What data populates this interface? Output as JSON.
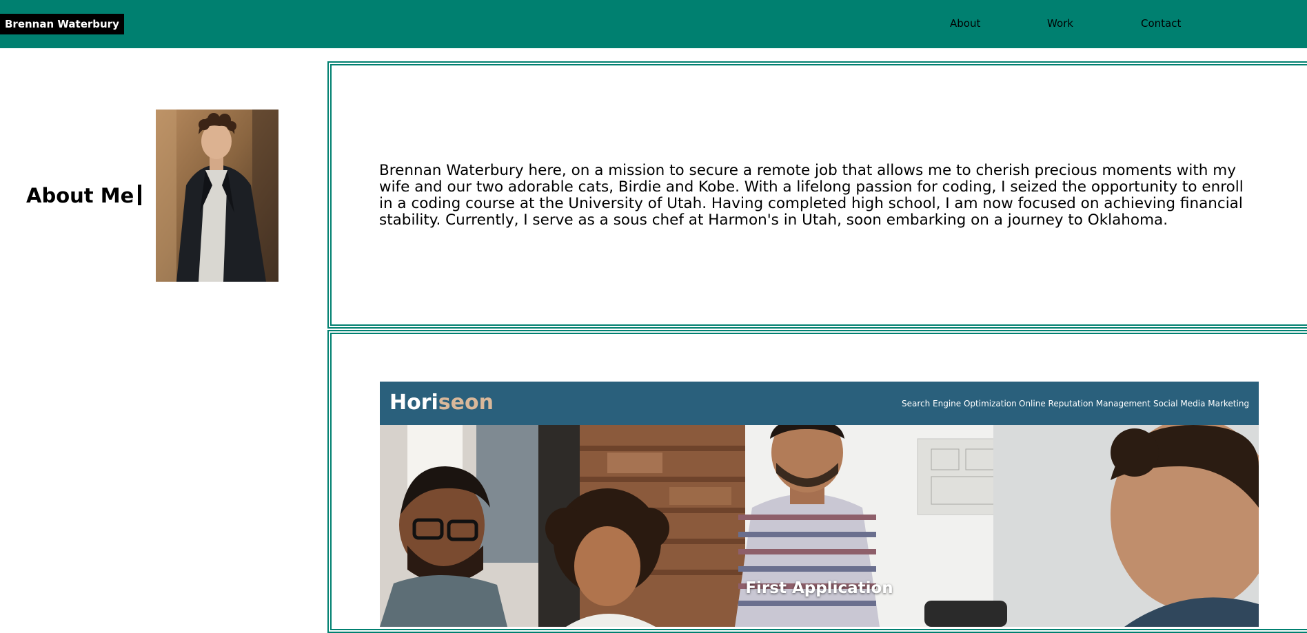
{
  "header": {
    "brand": "Brennan Waterbury",
    "nav": [
      "About",
      "Work",
      "Contact"
    ]
  },
  "about": {
    "heading": "About Me",
    "bio": "Brennan Waterbury here, on a mission to secure a remote job that allows me to cherish precious moments with my wife and our two adorable cats, Birdie and Kobe. With a lifelong passion for coding, I seized the opportunity to enroll in a coding course at the University of Utah. Having completed high school, I am now focused on achieving financial stability. Currently, I serve as a sous chef at Harmon's in Utah, soon embarking on a journey to Oklahoma."
  },
  "work": {
    "project": {
      "logo_main": "Hori",
      "logo_accent": "seon",
      "nav": [
        "Search Engine Optimization",
        "Online Reputation Management",
        "Social Media Marketing"
      ],
      "caption": "First Application"
    }
  },
  "colors": {
    "accent": "#008070",
    "brand_bg": "#000000",
    "project_header": "#2a607c",
    "logo_accent": "#d9b89a"
  },
  "icons": {
    "portrait": "portrait-photo",
    "project_screenshot": "team-meeting-photo"
  }
}
